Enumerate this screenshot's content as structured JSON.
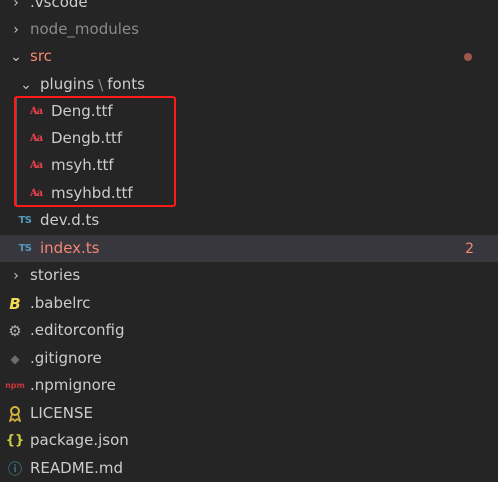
{
  "explorer": {
    "items": [
      {
        "label": ".vscode",
        "icon": "chevron-right-icon",
        "kind": "folder"
      },
      {
        "label": "node_modules",
        "icon": "chevron-right-icon",
        "kind": "folder"
      },
      {
        "label": "src",
        "icon": "chevron-down-icon",
        "kind": "folder",
        "status": "modified-dot"
      },
      {
        "label": "plugins",
        "sep": "\\",
        "label2": "fonts",
        "icon": "chevron-down-icon",
        "kind": "folder"
      },
      {
        "label": "Deng.ttf",
        "icon": "font-file-icon",
        "glyph": "Aa"
      },
      {
        "label": "Dengb.ttf",
        "icon": "font-file-icon",
        "glyph": "Aa"
      },
      {
        "label": "msyh.ttf",
        "icon": "font-file-icon",
        "glyph": "Aa"
      },
      {
        "label": "msyhbd.ttf",
        "icon": "font-file-icon",
        "glyph": "Aa"
      },
      {
        "label": "dev.d.ts",
        "icon": "typescript-file-icon",
        "glyph": "TS"
      },
      {
        "label": "index.ts",
        "icon": "typescript-file-icon",
        "glyph": "TS",
        "badge": "2"
      },
      {
        "label": "stories",
        "icon": "chevron-right-icon",
        "kind": "folder"
      },
      {
        "label": ".babelrc",
        "icon": "babel-file-icon",
        "glyph": "B"
      },
      {
        "label": ".editorconfig",
        "icon": "gear-icon",
        "glyph": "⚙"
      },
      {
        "label": ".gitignore",
        "icon": "git-file-icon",
        "glyph": "◆"
      },
      {
        "label": ".npmignore",
        "icon": "npm-file-icon",
        "glyph": "npm"
      },
      {
        "label": "LICENSE",
        "icon": "license-file-icon",
        "glyph": "🎗"
      },
      {
        "label": "package.json",
        "icon": "json-file-icon",
        "glyph": "{}"
      },
      {
        "label": "README.md",
        "icon": "info-file-icon",
        "glyph": "ⓘ"
      }
    ]
  },
  "colors": {
    "background": "#252526",
    "selected_row": "#37373d",
    "error_text": "#f48771",
    "highlight_box": "#ff1a1a"
  }
}
